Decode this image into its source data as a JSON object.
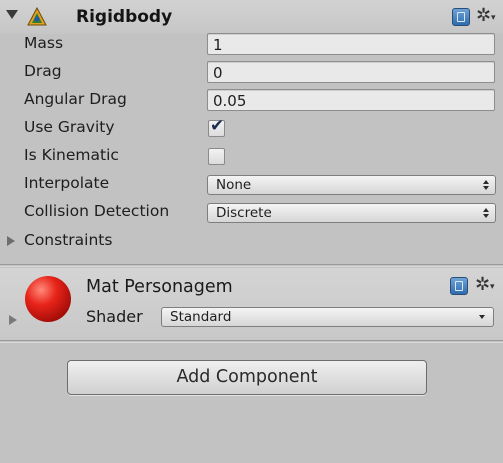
{
  "rigidbody": {
    "title": "Rigidbody",
    "properties": {
      "mass": {
        "label": "Mass",
        "value": "1"
      },
      "drag": {
        "label": "Drag",
        "value": "0"
      },
      "angular_drag": {
        "label": "Angular Drag",
        "value": "0.05"
      },
      "use_gravity": {
        "label": "Use Gravity",
        "checked": true
      },
      "is_kinematic": {
        "label": "Is Kinematic",
        "checked": false
      },
      "interpolate": {
        "label": "Interpolate",
        "value": "None"
      },
      "collision_detection": {
        "label": "Collision Detection",
        "value": "Discrete"
      }
    },
    "constraints_label": "Constraints",
    "icons": [
      "rigidbody-component-icon",
      "help-book-icon",
      "gear-icon"
    ]
  },
  "material": {
    "name": "Mat Personagem",
    "shader_label": "Shader",
    "shader_value": "Standard",
    "preview_color": "#e8241a",
    "icons": [
      "material-sphere-preview",
      "help-book-icon",
      "gear-icon"
    ]
  },
  "add_component": {
    "label": "Add Component"
  },
  "glyphs": {
    "checkmark": "✔",
    "gear": "✲",
    "caret": "▾"
  }
}
